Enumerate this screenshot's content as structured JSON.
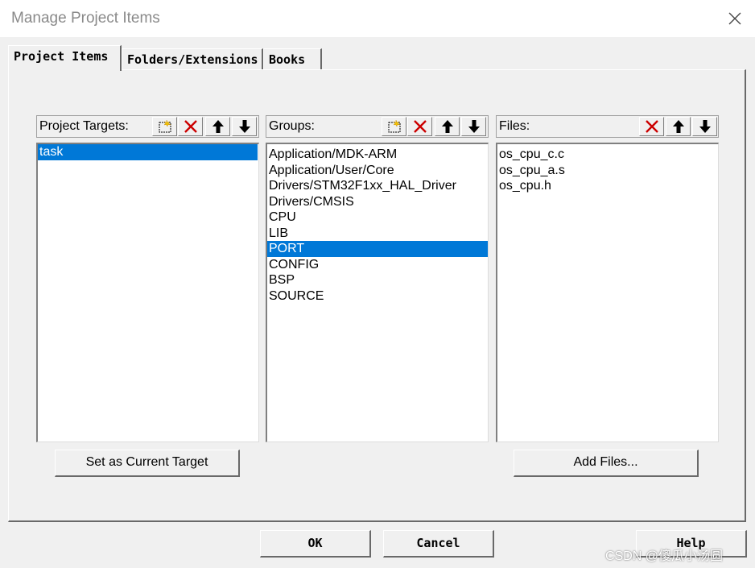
{
  "window": {
    "title": "Manage Project Items"
  },
  "tabs": [
    {
      "label": "Project Items",
      "active": true
    },
    {
      "label": "Folders/Extensions",
      "active": false
    },
    {
      "label": "Books",
      "active": false
    }
  ],
  "targets": {
    "header": "Project Targets:",
    "items": [
      {
        "label": "task",
        "selected": true
      }
    ],
    "button": "Set as Current Target"
  },
  "groups": {
    "header": "Groups:",
    "items": [
      {
        "label": "Application/MDK-ARM",
        "selected": false
      },
      {
        "label": "Application/User/Core",
        "selected": false
      },
      {
        "label": "Drivers/STM32F1xx_HAL_Driver",
        "selected": false
      },
      {
        "label": "Drivers/CMSIS",
        "selected": false
      },
      {
        "label": "CPU",
        "selected": false
      },
      {
        "label": "LIB",
        "selected": false
      },
      {
        "label": "PORT",
        "selected": true
      },
      {
        "label": "CONFIG",
        "selected": false
      },
      {
        "label": "BSP",
        "selected": false
      },
      {
        "label": "SOURCE",
        "selected": false
      }
    ]
  },
  "files": {
    "header": "Files:",
    "items": [
      {
        "label": "os_cpu_c.c"
      },
      {
        "label": "os_cpu_a.s"
      },
      {
        "label": "os_cpu.h"
      }
    ],
    "button": "Add Files..."
  },
  "footer": {
    "ok": "OK",
    "cancel": "Cancel",
    "help": "Help"
  },
  "watermark": "CSDN @傻瓜小汤圆",
  "colors": {
    "selection": "#0078d7",
    "delete_icon": "#cc0000",
    "title_text": "#8a8a8a"
  },
  "icons": [
    "new-icon",
    "delete-icon",
    "move-up-icon",
    "move-down-icon",
    "close-icon"
  ]
}
